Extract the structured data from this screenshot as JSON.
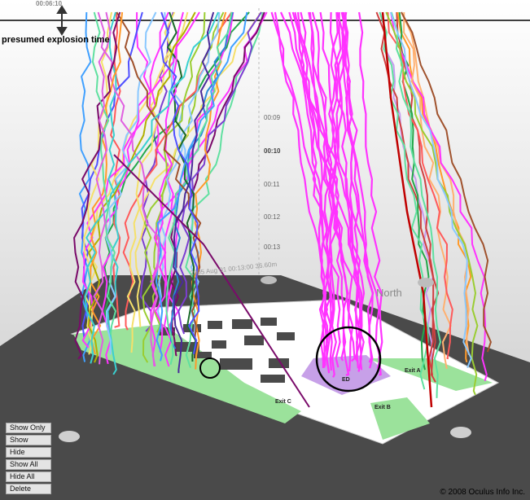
{
  "header": {
    "explosion_label": "presumed explosion time",
    "top_time": "00:06:10"
  },
  "axis": {
    "ticks": [
      "00:09",
      "00:10",
      "00:11",
      "00:12",
      "00:13"
    ],
    "highlight_tick": "00:10",
    "date_label": "2005 Aug 01 00:13:00  36.60m"
  },
  "map": {
    "north_label": "North",
    "zone_labels": [
      "Exit A",
      "Exit B",
      "Exit C",
      "ED"
    ]
  },
  "controls": {
    "show_only": "Show Only",
    "show": "Show",
    "hide": "Hide",
    "show_all": "Show All",
    "hide_all": "Hide All",
    "delete": "Delete"
  },
  "footer": {
    "copyright": "© 2008 Oculus Info Inc."
  },
  "colors": {
    "ground": "#4a4a4a",
    "floor": "#ffffff",
    "green_zone": "#9be29b",
    "purple_zone": "#c7a0e8",
    "magenta": "#ff33ff"
  }
}
